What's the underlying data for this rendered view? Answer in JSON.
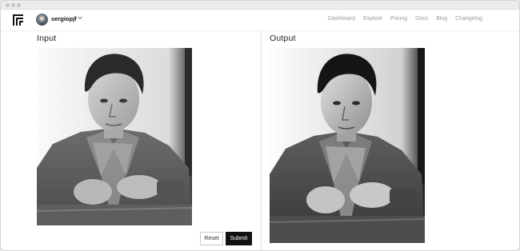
{
  "app": {
    "username": "sergiopjf",
    "logo_icon": "replicate-logo-icon",
    "avatar_icon": "user-avatar",
    "dropdown_icon": "chevron-down-icon"
  },
  "nav": {
    "links": [
      {
        "label": "Dashboard"
      },
      {
        "label": "Explore"
      },
      {
        "label": "Pricing"
      },
      {
        "label": "Docs"
      },
      {
        "label": "Blog"
      },
      {
        "label": "Changelog"
      }
    ]
  },
  "input_panel": {
    "title": "Input",
    "image_content": "black-and-white portrait photo"
  },
  "output_panel": {
    "title": "Output",
    "image_content": "black-and-white portrait photo"
  },
  "actions": {
    "reset_label": "Reset",
    "submit_label": "Submit"
  },
  "colors": {
    "accent": "#111111",
    "nav_text": "#9a9a9a",
    "divider": "#e4e4e4"
  }
}
